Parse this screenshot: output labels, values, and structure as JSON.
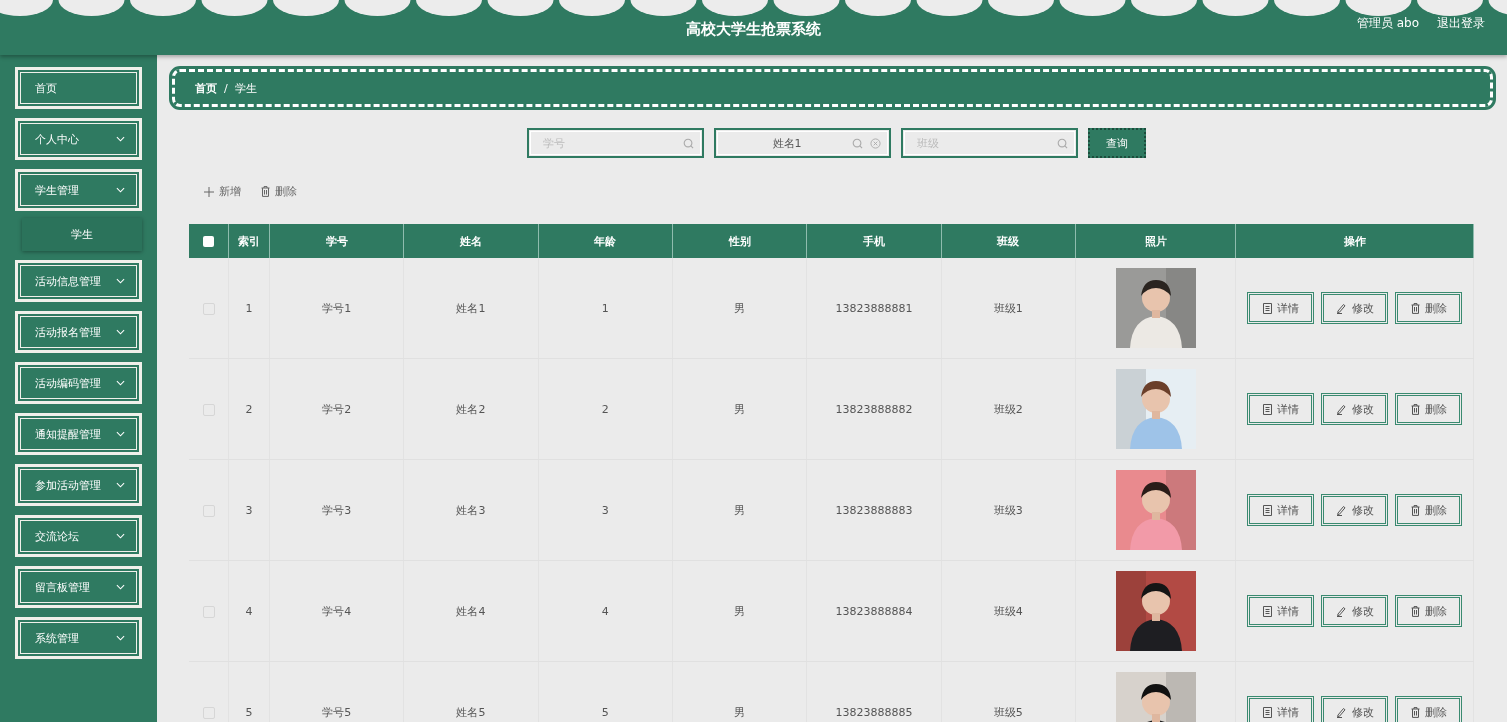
{
  "header": {
    "title": "高校大学生抢票系统",
    "user": "管理员 abo",
    "logout": "退出登录"
  },
  "sidebar": {
    "items": [
      {
        "label": "首页",
        "has_children": false
      },
      {
        "label": "个人中心",
        "has_children": true
      },
      {
        "label": "学生管理",
        "has_children": true,
        "children": [
          {
            "label": "学生",
            "selected": true
          }
        ]
      },
      {
        "label": "活动信息管理",
        "has_children": true
      },
      {
        "label": "活动报名管理",
        "has_children": true
      },
      {
        "label": "活动编码管理",
        "has_children": true
      },
      {
        "label": "通知提醒管理",
        "has_children": true
      },
      {
        "label": "参加活动管理",
        "has_children": true
      },
      {
        "label": "交流论坛",
        "has_children": true
      },
      {
        "label": "留言板管理",
        "has_children": true
      },
      {
        "label": "系统管理",
        "has_children": true
      }
    ]
  },
  "breadcrumb": {
    "items": [
      "首页",
      "学生"
    ],
    "separator": "/"
  },
  "search": {
    "fields": [
      {
        "placeholder": "学号",
        "clearable": false
      },
      {
        "value": "姓名1",
        "clearable": true
      },
      {
        "placeholder": "班级",
        "clearable": false
      }
    ],
    "button": "查询"
  },
  "toolbar": [
    {
      "kind": "add",
      "label": "新增"
    },
    {
      "kind": "delete",
      "label": "删除"
    }
  ],
  "table": {
    "select_all_checked": false,
    "columns": [
      "索引",
      "学号",
      "姓名",
      "年龄",
      "性别",
      "手机",
      "班级",
      "照片",
      "操作"
    ],
    "rows": [
      {
        "checked": false,
        "cells": [
          "1",
          "学号1",
          "姓名1",
          "1",
          "男",
          "13823888881",
          "班级1"
        ],
        "actions": [
          "详情",
          "修改",
          "删除"
        ]
      },
      {
        "checked": false,
        "cells": [
          "2",
          "学号2",
          "姓名2",
          "2",
          "男",
          "13823888882",
          "班级2"
        ],
        "actions": [
          "详情",
          "修改",
          "删除"
        ]
      },
      {
        "checked": false,
        "cells": [
          "3",
          "学号3",
          "姓名3",
          "3",
          "男",
          "13823888883",
          "班级3"
        ],
        "actions": [
          "详情",
          "修改",
          "删除"
        ]
      },
      {
        "checked": false,
        "cells": [
          "4",
          "学号4",
          "姓名4",
          "4",
          "男",
          "13823888884",
          "班级4"
        ],
        "actions": [
          "详情",
          "修改",
          "删除"
        ]
      },
      {
        "checked": false,
        "cells": [
          "5",
          "学号5",
          "姓名5",
          "5",
          "男",
          "13823888885",
          "班级5"
        ],
        "actions": [
          "详情",
          "修改",
          "删除"
        ]
      }
    ]
  }
}
